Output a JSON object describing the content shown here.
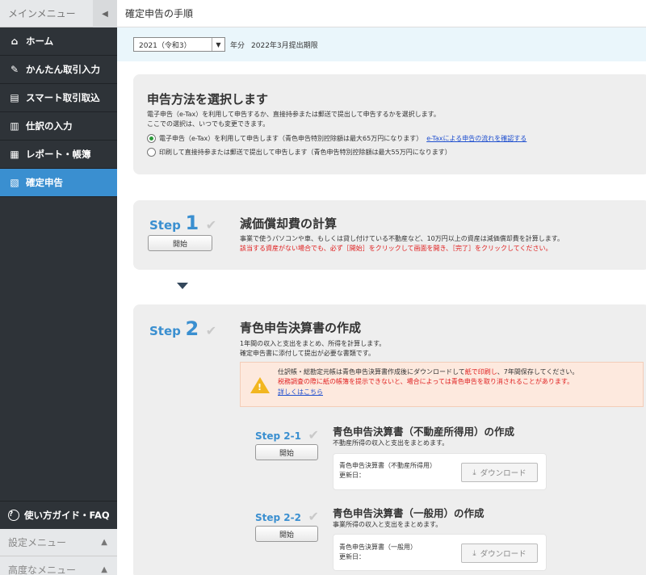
{
  "sidebar": {
    "header": "メインメニュー",
    "collapse_icon": "◀",
    "items": [
      {
        "icon": "home-icon",
        "glyph": "⌂",
        "label": "ホーム"
      },
      {
        "icon": "pencil-icon",
        "glyph": "✎",
        "label": "かんたん取引入力"
      },
      {
        "icon": "smart-import-icon",
        "glyph": "▤",
        "label": "スマート取引取込"
      },
      {
        "icon": "journal-icon",
        "glyph": "▥",
        "label": "仕訳の入力"
      },
      {
        "icon": "report-icon",
        "glyph": "▦",
        "label": "レポート・帳簿"
      },
      {
        "icon": "tax-return-icon",
        "glyph": "▧",
        "label": "確定申告"
      }
    ],
    "faq": {
      "glyph": "?",
      "label": "使い方ガイド・FAQ"
    },
    "settings_menu": "設定メニュー",
    "advanced_menu": "高度なメニュー",
    "expand_glyph": "▲"
  },
  "main": {
    "title": "確定申告の手順",
    "year_select": "2021（令和3）",
    "year_suffix": "年分",
    "deadline": "2022年3月提出期限",
    "method": {
      "heading": "申告方法を選択します",
      "desc1": "電子申告（e-Tax）を利用して申告するか、直接持参または郵送で提出して申告するかを選択します。",
      "desc2": "ここでの選択は、いつでも変更できます。",
      "option1": "電子申告（e-Tax）を利用して申告します（青色申告特別控除額は最大65万円になります）",
      "option1_link": "e-Taxによる申告の流れを確認する",
      "option2": "印刷して直接持参または郵送で提出して申告します（青色申告特別控除額は最大55万円になります）"
    },
    "step1": {
      "label": "Step",
      "num": "1",
      "title": "減価償却費の計算",
      "start": "開始",
      "desc": "事業で使うパソコンや車、もしくは貸し付けている不動産など、10万円以上の資産は減価償却費を計算します。",
      "note": "該当する資産がない場合でも、必ず［開始］をクリックして画面を開き、［完了］をクリックしてください。"
    },
    "step2": {
      "label": "Step",
      "num": "2",
      "title": "青色申告決算書の作成",
      "desc1": "1年間の収入と支出をまとめ、所得を計算します。",
      "desc2": "確定申告書に添付して提出が必要な書類です。",
      "warn1a": "仕訳帳・総勘定元帳は青色申告決算書作成後にダウンロードして",
      "warn1b": "紙で印刷し",
      "warn1c": "、7年間保存してください。",
      "warn2": "税務調査の際に紙の帳簿を提示できないと、場合によっては青色申告を取り消されることがあります。",
      "warn_link": "詳しくはこちら"
    },
    "step21": {
      "label": "Step 2-1",
      "title": "青色申告決算書（不動産所得用）の作成",
      "desc": "不動産所得の収入と支出をまとめます。",
      "start": "開始",
      "doc": "青色申告決算書（不動産所得用）",
      "updated": "更新日：",
      "download": "ダウンロード"
    },
    "step22": {
      "label": "Step 2-2",
      "title": "青色申告決算書（一般用）の作成",
      "desc": "事業所得の収入と支出をまとめます。",
      "start": "開始",
      "doc": "青色申告決算書（一般用）",
      "updated": "更新日：",
      "download": "ダウンロード"
    },
    "check_glyph": "✔",
    "download_glyph": "⤓"
  }
}
